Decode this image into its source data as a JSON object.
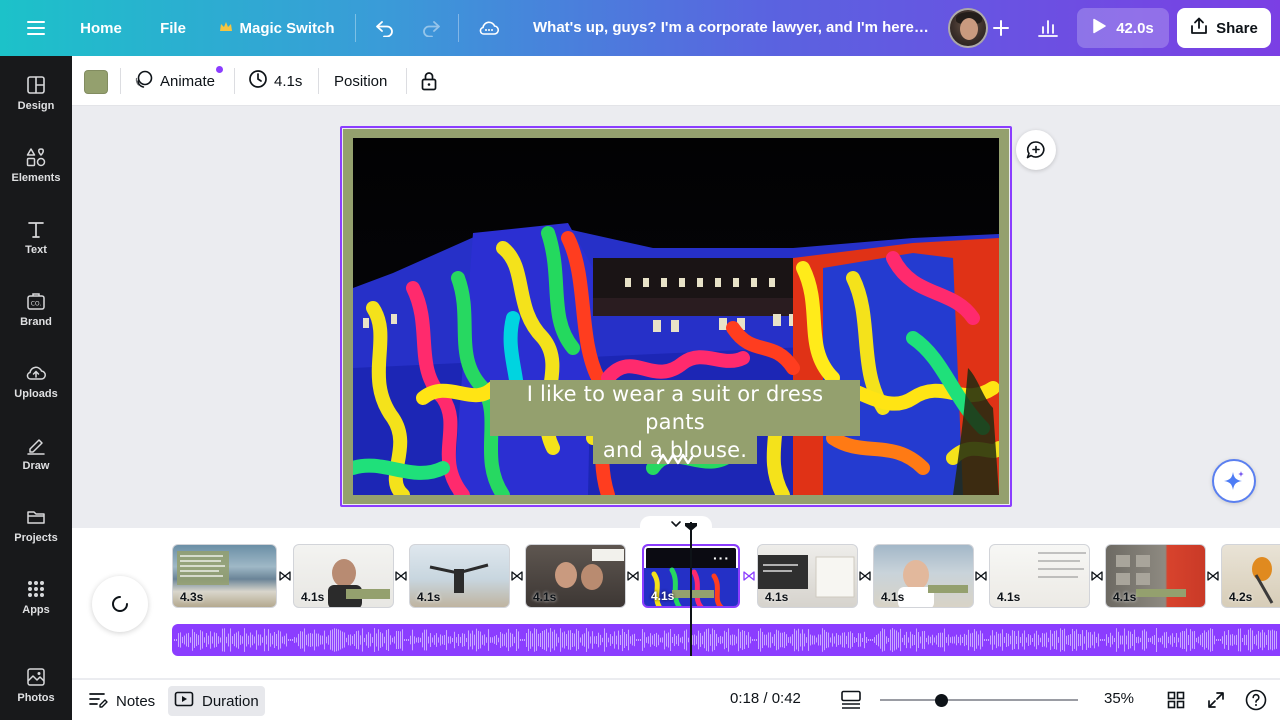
{
  "topbar": {
    "home_label": "Home",
    "file_label": "File",
    "magic_switch_label": "Magic Switch",
    "design_title": "What's up, guys? I'm a corporate lawyer, and I'm here to ...",
    "play_duration": "42.0s",
    "share_label": "Share"
  },
  "sidebar": {
    "items": [
      {
        "label": "Design",
        "icon": "layout-icon"
      },
      {
        "label": "Elements",
        "icon": "shapes-icon"
      },
      {
        "label": "Text",
        "icon": "text-icon"
      },
      {
        "label": "Brand",
        "icon": "brand-icon"
      },
      {
        "label": "Uploads",
        "icon": "cloud-upload-icon"
      },
      {
        "label": "Draw",
        "icon": "pen-icon"
      },
      {
        "label": "Projects",
        "icon": "folder-icon"
      },
      {
        "label": "Apps",
        "icon": "grid-icon"
      },
      {
        "label": "Photos",
        "icon": "image-icon"
      }
    ]
  },
  "toolbar": {
    "color_swatch": "#94a06e",
    "animate_label": "Animate",
    "timing_label": "4.1s",
    "position_label": "Position"
  },
  "canvas": {
    "caption_line1": "I like to wear a suit or dress pants",
    "caption_line2": "and a blouse.",
    "page_color": "#94a06e"
  },
  "timeline": {
    "clips": [
      {
        "duration": "4.3s"
      },
      {
        "duration": "4.1s"
      },
      {
        "duration": "4.1s"
      },
      {
        "duration": "4.1s"
      },
      {
        "duration": "4.1s",
        "selected": true
      },
      {
        "duration": "4.1s"
      },
      {
        "duration": "4.1s"
      },
      {
        "duration": "4.1s"
      },
      {
        "duration": "4.1s"
      },
      {
        "duration": "4.2s"
      }
    ],
    "accent_color": "#8b3dff"
  },
  "footer": {
    "notes_label": "Notes",
    "duration_label": "Duration",
    "time_readout": "0:18 / 0:42",
    "zoom_level": "35%"
  }
}
